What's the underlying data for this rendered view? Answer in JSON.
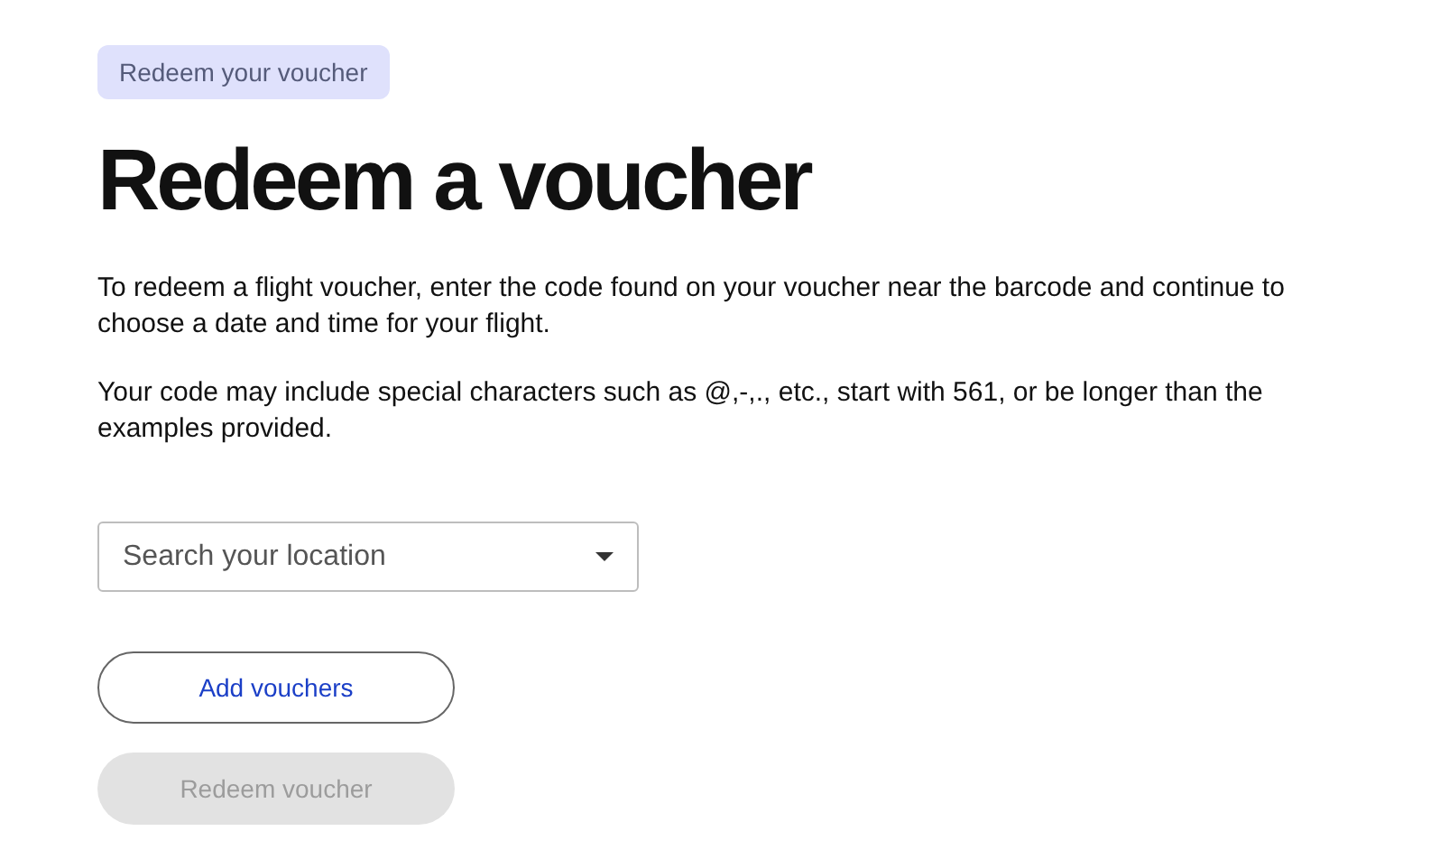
{
  "badge": "Redeem your voucher",
  "heading": "Redeem a voucher",
  "paragraphs": [
    "To redeem a flight voucher, enter the code found on your voucher near the barcode and continue to choose a date and time for your flight.",
    "Your code may include special characters such as @,-,., etc., start with 561, or be longer than the examples provided."
  ],
  "location_select": {
    "placeholder": "Search your location"
  },
  "buttons": [
    {
      "label": "Add vouchers",
      "kind": "outline",
      "disabled": false
    },
    {
      "label": "Redeem voucher",
      "kind": "filled",
      "disabled": true
    }
  ]
}
